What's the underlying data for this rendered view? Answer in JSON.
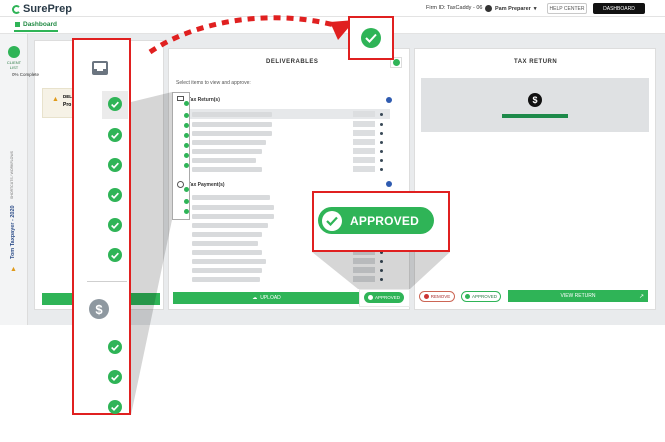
{
  "app": {
    "logo": "SurePrep",
    "firm_id": "Firm ID: TaxCaddy - 06",
    "user": "Pam Preparer",
    "help_label": "HELP CENTER",
    "dashboard_label": "DASHBOARD"
  },
  "nav": {
    "tab": "Dashboard"
  },
  "rail": {
    "client_list": "CLIENT LIST",
    "taxpayer": "Tom Taxpayer - 2020",
    "section": "SHORTCUTS / WORKFLOWS"
  },
  "left_panel": {
    "completion": "0% Complete",
    "warn_code": "DEL",
    "warn_text": "Pro"
  },
  "deliverables": {
    "title": "DELIVERABLES",
    "hint": "Select items to view and approve:",
    "sections": [
      {
        "label": "Tax Return(s)"
      },
      {
        "label": "Tax Payment(s)"
      }
    ],
    "upload": "UPLOAD",
    "approved_small": "APPROVED"
  },
  "tax_return": {
    "title": "TAX RETURN",
    "remove": "REMOVE",
    "approved": "APPROVED",
    "view_return": "VIEW RETURN"
  },
  "callout": {
    "approved_label": "APPROVED"
  },
  "colors": {
    "accent": "#2fb457",
    "highlight": "#e02020"
  }
}
